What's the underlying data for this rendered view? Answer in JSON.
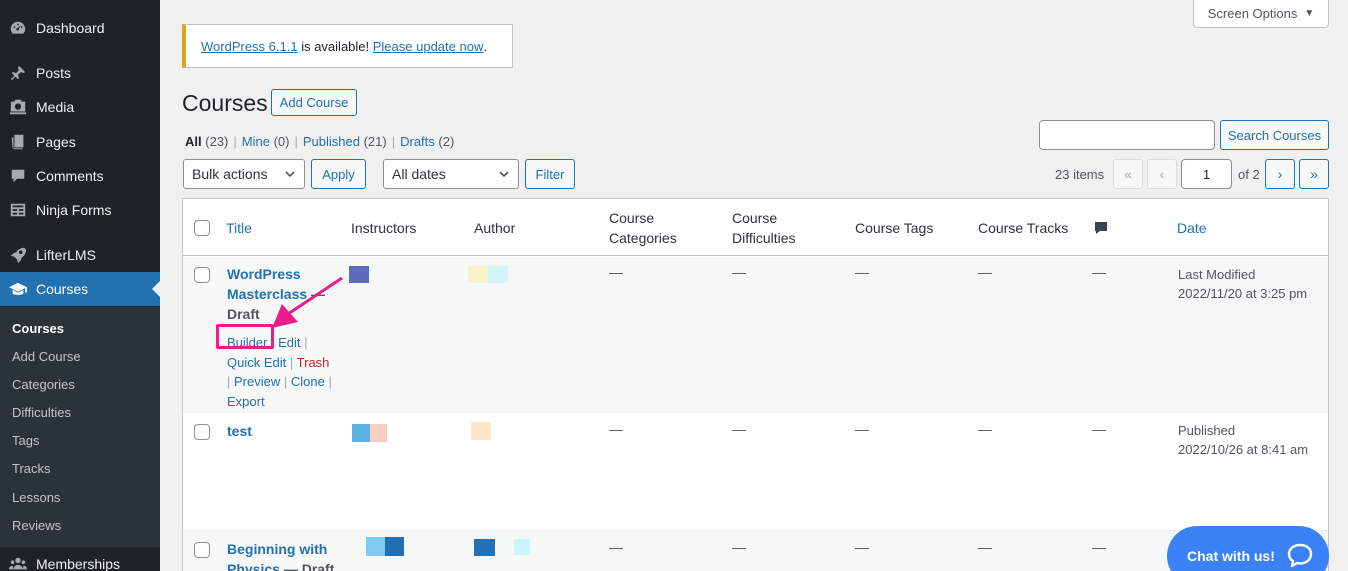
{
  "sidebar": {
    "items": [
      {
        "label": "Dashboard",
        "icon": "dashboard-icon"
      },
      {
        "label": "Posts",
        "icon": "pin-icon"
      },
      {
        "label": "Media",
        "icon": "media-icon"
      },
      {
        "label": "Pages",
        "icon": "pages-icon"
      },
      {
        "label": "Comments",
        "icon": "comment-icon"
      },
      {
        "label": "Ninja Forms",
        "icon": "forms-icon"
      },
      {
        "label": "LifterLMS",
        "icon": "rocket-icon"
      },
      {
        "label": "Courses",
        "icon": "graduation-cap-icon"
      },
      {
        "label": "Memberships",
        "icon": "group-icon"
      }
    ],
    "submenu": [
      "Courses",
      "Add Course",
      "Categories",
      "Difficulties",
      "Tags",
      "Tracks",
      "Lessons",
      "Reviews"
    ]
  },
  "screen_options": "Screen Options",
  "notice": {
    "version_link": "WordPress 6.1.1",
    "middle": " is available! ",
    "update_link": "Please update now",
    "end": "."
  },
  "page": {
    "title": "Courses",
    "add_button": "Add Course"
  },
  "views": {
    "all": "All",
    "all_count": "(23)",
    "mine": "Mine",
    "mine_count": "(0)",
    "published": "Published",
    "published_count": "(21)",
    "drafts": "Drafts",
    "drafts_count": "(2)",
    "sep": "|"
  },
  "search": {
    "button": "Search Courses",
    "value": ""
  },
  "toolbar": {
    "bulk": "Bulk actions",
    "apply": "Apply",
    "dates": "All dates",
    "filter": "Filter"
  },
  "pagination": {
    "items": "23 items",
    "first": "«",
    "prev": "‹",
    "current": "1",
    "of": "of 2",
    "next": "›",
    "last": "»"
  },
  "table": {
    "headers": {
      "title": "Title",
      "instructors": "Instructors",
      "author": "Author",
      "categories": "Course Categories",
      "difficulties": "Course Difficulties",
      "tags": "Course Tags",
      "tracks": "Course Tracks",
      "comments_icon": "comment-bubble-icon",
      "date": "Date"
    },
    "rows": [
      {
        "title": "WordPress Masterclass",
        "state": " — Draft",
        "categories": "—",
        "difficulties": "—",
        "tags": "—",
        "tracks": "—",
        "comments": "—",
        "date_status": "Last Modified",
        "date": "2022/11/20 at 3:25 pm",
        "actions": {
          "builder": "Builder",
          "edit": "Edit",
          "quick_edit": "Quick Edit",
          "trash": "Trash",
          "preview": "Preview",
          "clone": "Clone",
          "export": "Export",
          "sep": "|"
        }
      },
      {
        "title": "test",
        "state": "",
        "categories": "—",
        "difficulties": "—",
        "tags": "—",
        "tracks": "—",
        "comments": "—",
        "date_status": "Published",
        "date": "2022/10/26 at 8:41 am"
      },
      {
        "title": "Beginning with Physics",
        "state": " — Draft",
        "categories": "—",
        "difficulties": "—",
        "tags": "—",
        "tracks": "—",
        "comments": "—"
      }
    ]
  },
  "chat": {
    "label": "Chat with us!"
  },
  "colors": {
    "accent": "#2271b1",
    "sidebar": "#1d2327",
    "highlight": "#e91e8c",
    "notice": "#dba617",
    "chat": "#3b82f6"
  }
}
